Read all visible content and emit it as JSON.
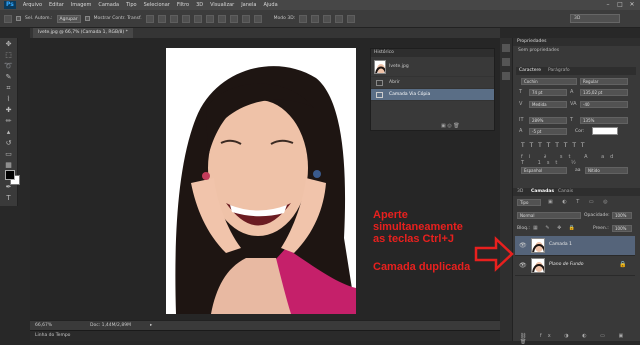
{
  "menubar": {
    "logo": "Ps",
    "items": [
      "Arquivo",
      "Editar",
      "Imagem",
      "Camada",
      "Tipo",
      "Selecionar",
      "Filtro",
      "3D",
      "Visualizar",
      "Janela",
      "Ajuda"
    ]
  },
  "optbar": {
    "sel_auto": "Sel. Autom.:",
    "grupo": "Agrupar",
    "mostrar": "Mostrar Contr. Transf.",
    "modo3d": "Modo 3D:",
    "workspace": "3D"
  },
  "document": {
    "tab": "Ivete.jpg @ 66,7% (Camada 1, RGB/8) *",
    "zoom": "66,67%",
    "doc_info": "Doc: 1,44M/2,89M",
    "timeline": "Linha do Tempo"
  },
  "history": {
    "title": "Histórico",
    "snapshot": "Ivete.jpg",
    "items": [
      "Abrir",
      "Camada Via Cópia"
    ]
  },
  "properties": {
    "title": "Propriedades",
    "subtitle": "Sem propriedades"
  },
  "character": {
    "tabs": [
      "Caractere",
      "Parágrafo"
    ],
    "font": "Cochin",
    "style": "Regular",
    "size": "74 pt",
    "leading": "135,02 pt",
    "kerning": "Medida",
    "tracking": "-40",
    "vscale": "289%",
    "hscale": "135%",
    "baseline": "-5 pt",
    "color_label": "Cor:",
    "language": "Espanhol",
    "aa_label": "aa",
    "aa_mode": "Nítido"
  },
  "layers_panel": {
    "tabs": [
      "3D",
      "Camadas",
      "Canais"
    ],
    "kind": "Tipo",
    "blend": "Normal",
    "opacity_label": "Opacidade:",
    "opacity": "100%",
    "lock_label": "Bloq.:",
    "fill_label": "Preen.:",
    "fill": "100%",
    "layers": [
      {
        "name": "Camada 1"
      },
      {
        "name": "Plano de Fundo"
      }
    ]
  },
  "annotations": {
    "line1": "Aperte",
    "line2": "simultaneamente",
    "line3": "as teclas Ctrl+J",
    "line4": "Camada duplicada"
  },
  "colors": {
    "annotation": "#e8201e",
    "selection": "#55647a",
    "history_selection": "#5a6e86"
  }
}
